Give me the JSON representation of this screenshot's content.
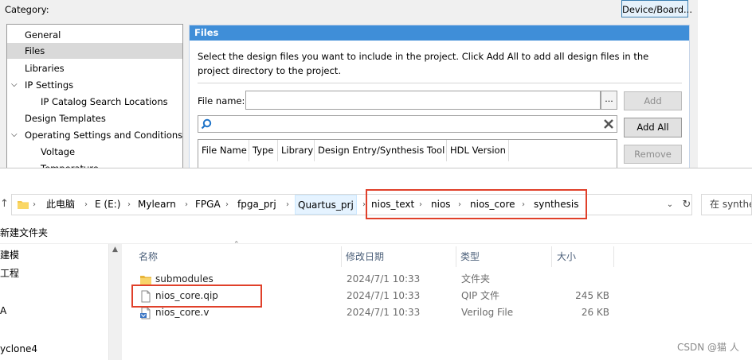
{
  "dialog": {
    "category_label": "Category:",
    "device_button": "Device/Board...",
    "tree": [
      {
        "label": "General",
        "selected": false
      },
      {
        "label": "Files",
        "selected": true
      },
      {
        "label": "Libraries",
        "selected": false
      },
      {
        "label": "IP Settings",
        "selected": false
      },
      {
        "label": "IP Catalog Search Locations",
        "selected": false
      },
      {
        "label": "Design Templates",
        "selected": false
      },
      {
        "label": "Operating Settings and Conditions",
        "selected": false
      },
      {
        "label": "Voltage",
        "selected": false
      },
      {
        "label": "Temperature",
        "selected": false
      }
    ],
    "files_panel": {
      "title": "Files",
      "description": "Select the design files you want to include in the project. Click Add All to add all design files in the project directory to the project.",
      "filename_label": "File name:",
      "filename_value": "",
      "browse_label": "...",
      "add_label": "Add",
      "add_all_label": "Add All",
      "remove_label": "Remove",
      "search_value": "",
      "columns": [
        "File Name",
        "Type",
        "Library",
        "Design Entry/Synthesis Tool",
        "HDL Version"
      ]
    }
  },
  "explorer": {
    "breadcrumbs": [
      "此电脑",
      "E (E:)",
      "Mylearn",
      "FPGA",
      "fpga_prj",
      "Quartus_prj",
      "nios_text",
      "nios",
      "nios_core",
      "synthesis"
    ],
    "search_placeholder": "在 synthe",
    "toolbar_new_folder": "新建文件夹",
    "nav_items": [
      "建模",
      "工程",
      "A",
      "yclone4"
    ],
    "columns": {
      "name": "名称",
      "date": "修改日期",
      "type": "类型",
      "size": "大小"
    },
    "files": [
      {
        "name": "submodules",
        "date": "2024/7/1 10:33",
        "type": "文件夹",
        "size": "",
        "icon": "folder-icon"
      },
      {
        "name": "nios_core.qip",
        "date": "2024/7/1 10:33",
        "type": "QIP 文件",
        "size": "245 KB",
        "icon": "file-icon"
      },
      {
        "name": "nios_core.v",
        "date": "2024/7/1 10:33",
        "type": "Verilog File",
        "size": "26 KB",
        "icon": "verilog-file-icon"
      }
    ]
  },
  "colors": {
    "highlight": "#e0402a",
    "header_blue": "#3f8ed8"
  },
  "watermark": "CSDN @猫 人"
}
